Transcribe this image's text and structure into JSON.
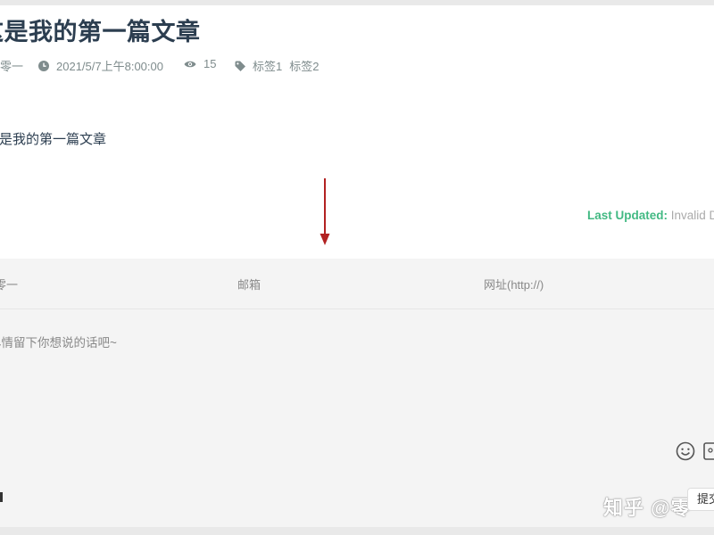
{
  "post": {
    "title": "这是我的第一篇文章",
    "author": "零一",
    "date": "2021/5/7上午8:00:00",
    "views": "15",
    "tags": [
      "标签1",
      "标签2"
    ],
    "body": "这是我的第一篇文章"
  },
  "last_updated": {
    "label": "Last Updated:",
    "value": "Invalid Date"
  },
  "comments": {
    "nick_placeholder": "昵称零一",
    "email_placeholder": "邮箱",
    "url_placeholder": "网址(http://)",
    "content_placeholder": "尽情留下你想说的话吧~",
    "submit_label": "提交"
  },
  "watermark": "知乎 @零一",
  "icons": {
    "author": "user-icon",
    "date": "clock-icon",
    "views": "eye-icon",
    "tags": "tag-icon",
    "emoji": "smile-icon",
    "image": "image-icon",
    "markdown": "markdown-icon"
  },
  "colors": {
    "accent": "#42b983",
    "text": "#2c3e50",
    "meta": "#7f8c8d",
    "panel": "#f4f4f4",
    "annotation_arrow": "#b22222"
  }
}
